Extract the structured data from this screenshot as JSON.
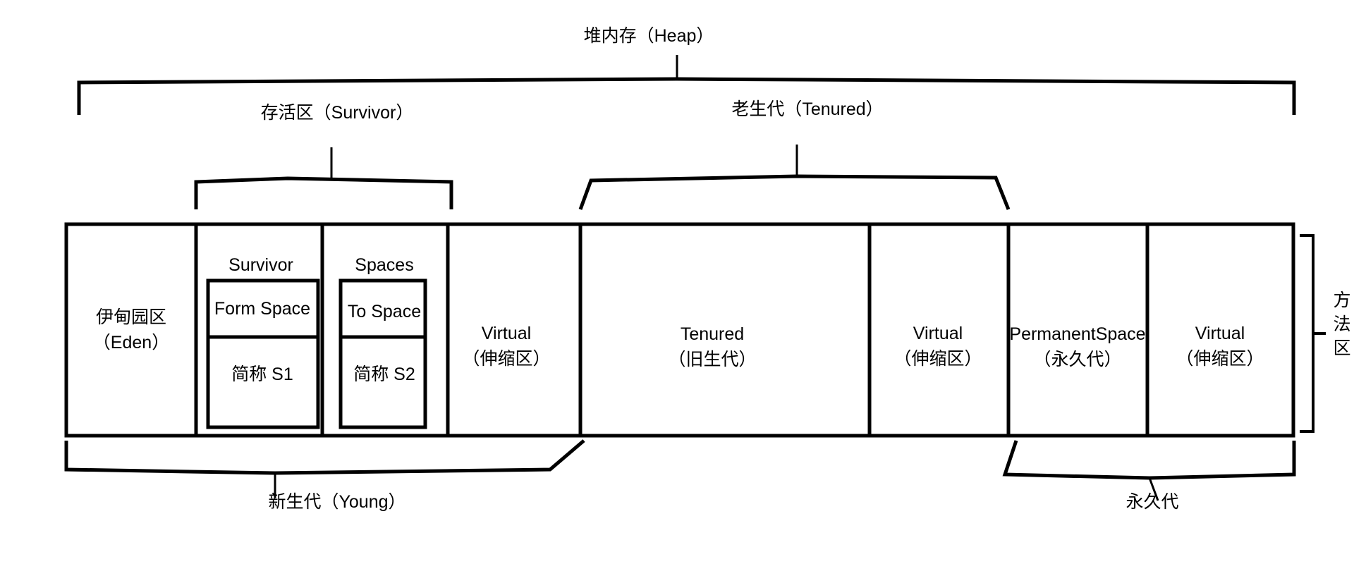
{
  "diagram": {
    "title_top": "堆内存（Heap）",
    "brackets": {
      "heap": "堆内存（Heap）",
      "survivor": "存活区（Survivor）",
      "tenured": "老生代（Tenured）",
      "young": "新生代（Young）",
      "permanent": "永久代",
      "method_area": "方法区"
    },
    "method_area_chars": [
      "方",
      "法",
      "区"
    ],
    "columns": [
      {
        "id": "eden",
        "name": "eden-region",
        "line1": "伊甸园区",
        "line2": "（Eden）",
        "header": "",
        "inner": null
      },
      {
        "id": "survivor-from",
        "name": "survivor-from-region",
        "line1": "",
        "line2": "",
        "header": "Survivor",
        "inner": {
          "top": "Form  Space",
          "bottom": "简称 S1"
        }
      },
      {
        "id": "survivor-to",
        "name": "survivor-to-region",
        "line1": "",
        "line2": "",
        "header": "Spaces",
        "inner": {
          "top": "To Space",
          "bottom": "简称 S2"
        }
      },
      {
        "id": "virtual-young",
        "name": "virtual-young-region",
        "line1": "Virtual",
        "line2": "（伸缩区）",
        "header": "",
        "inner": null
      },
      {
        "id": "tenured",
        "name": "tenured-region",
        "line1": "Tenured",
        "line2": "（旧生代）",
        "header": "",
        "inner": null
      },
      {
        "id": "virtual-tenured",
        "name": "virtual-tenured-region",
        "line1": "Virtual",
        "line2": "（伸缩区）",
        "header": "",
        "inner": null
      },
      {
        "id": "permanent-space",
        "name": "permanent-space-region",
        "line1": "PermanentSpace",
        "line2": "（永久代）",
        "header": "",
        "inner": null
      },
      {
        "id": "virtual-permanent",
        "name": "virtual-permanent-region",
        "line1": "Virtual",
        "line2": "（伸缩区）",
        "header": "",
        "inner": null
      }
    ],
    "colors": {
      "stroke": "#000000",
      "background": "#ffffff"
    }
  }
}
